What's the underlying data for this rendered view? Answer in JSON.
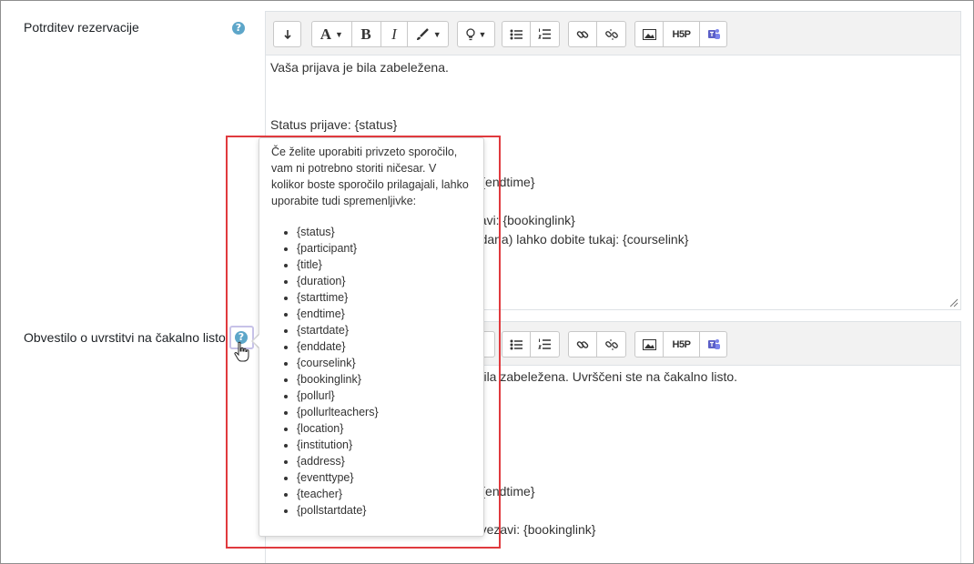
{
  "fields": [
    {
      "label": "Potrditev rezervacije",
      "help_icon": "?",
      "toolbar": [
        "collapse-icon",
        "font-icon",
        "bold-icon",
        "italic-icon",
        "paint-brush-icon",
        "lightbulb-icon",
        "bullet-list-icon",
        "numbered-list-icon",
        "link-icon",
        "unlink-icon",
        "image-icon",
        "h5p-icon",
        "teams-icon"
      ],
      "content_lines": [
        "Vaša prijava je bila zabeležena.",
        "Status prijave: {status}",
        "e} {endtime}",
        "ezavi: {bookinglink}",
        "podana) lahko dobite tukaj: {courselink}"
      ]
    },
    {
      "label": "Obvestilo o uvrstitvi na čakalno listo",
      "help_icon": "?",
      "content_lines": [
        "e bila zabeležena. Uvrščeni ste na čakalno listo.",
        "e} {endtime}",
        "povezavi: {bookinglink}"
      ]
    }
  ],
  "toolbar_labels": {
    "font": "A",
    "bold": "B",
    "italic": "I",
    "h5p": "H5P"
  },
  "popover": {
    "intro": "Če želite uporabiti privzeto sporočilo, vam ni potrebno storiti ničesar. V kolikor boste sporočilo prilagajali, lahko uporabite tudi spremenljivke:",
    "items": [
      "{status}",
      "{participant}",
      "{title}",
      "{duration}",
      "{starttime}",
      "{endtime}",
      "{startdate}",
      "{enddate}",
      "{courselink}",
      "{bookinglink}",
      "{pollurl}",
      "{pollurlteachers}",
      "{location}",
      "{institution}",
      "{address}",
      "{eventtype}",
      "{teacher}",
      "{pollstartdate}"
    ]
  },
  "colors": {
    "help_icon": "#5da6c9",
    "highlight": "#e03a3e",
    "teams": "#5b5fc7"
  }
}
